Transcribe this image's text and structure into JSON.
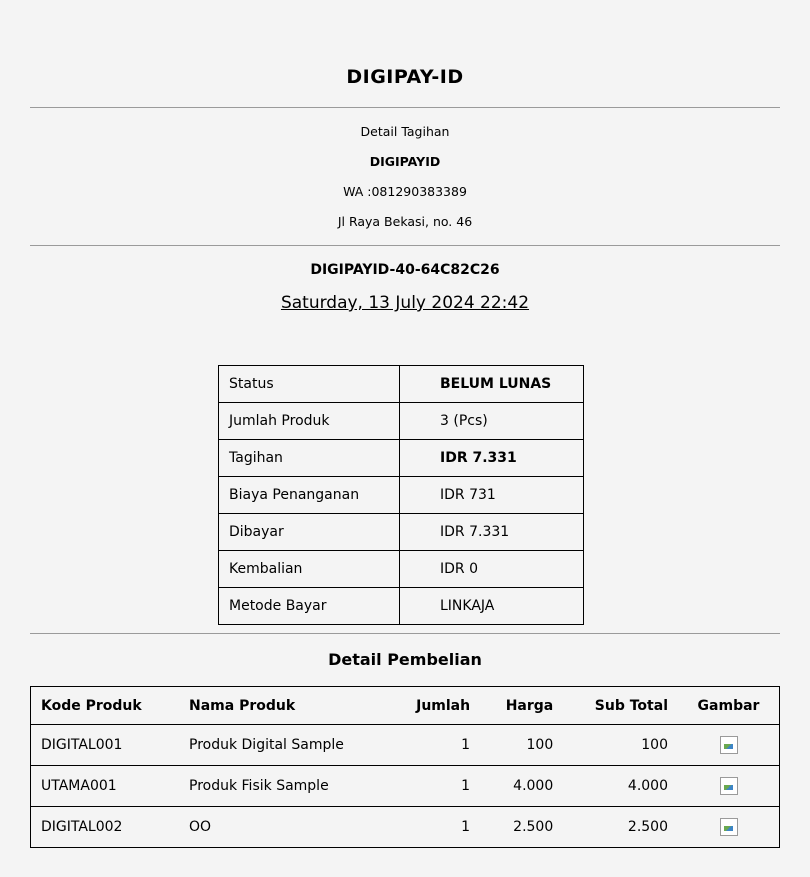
{
  "header": {
    "title": "DIGIPAY-ID",
    "subtitle": "Detail Tagihan",
    "store_name": "DIGIPAYID",
    "whatsapp": "WA :081290383389",
    "address": "Jl Raya Bekasi, no. 46"
  },
  "invoice": {
    "id": "DIGIPAYID-40-64C82C26",
    "datetime": "Saturday, 13 July 2024 22:42"
  },
  "summary": [
    {
      "label": "Status",
      "value": "BELUM LUNAS"
    },
    {
      "label": "Jumlah Produk",
      "value": "3 (Pcs)"
    },
    {
      "label": "Tagihan",
      "value": "IDR 7.331"
    },
    {
      "label": "Biaya Penanganan",
      "value": "IDR 731"
    },
    {
      "label": "Dibayar",
      "value": "IDR 7.331"
    },
    {
      "label": "Kembalian",
      "value": "IDR 0"
    },
    {
      "label": "Metode Bayar",
      "value": "LINKAJA"
    }
  ],
  "purchase": {
    "title": "Detail Pembelian",
    "columns": [
      "Kode Produk",
      "Nama Produk",
      "Jumlah",
      "Harga",
      "Sub Total",
      "Gambar"
    ],
    "rows": [
      {
        "code": "DIGITAL001",
        "name": "Produk Digital Sample",
        "qty": "1",
        "price": "100",
        "subtotal": "100",
        "image_icon": "broken-image-icon"
      },
      {
        "code": "UTAMA001",
        "name": "Produk Fisik Sample",
        "qty": "1",
        "price": "4.000",
        "subtotal": "4.000",
        "image_icon": "broken-image-icon"
      },
      {
        "code": "DIGITAL002",
        "name": "OO",
        "qty": "1",
        "price": "2.500",
        "subtotal": "2.500",
        "image_icon": "broken-image-icon"
      }
    ]
  }
}
